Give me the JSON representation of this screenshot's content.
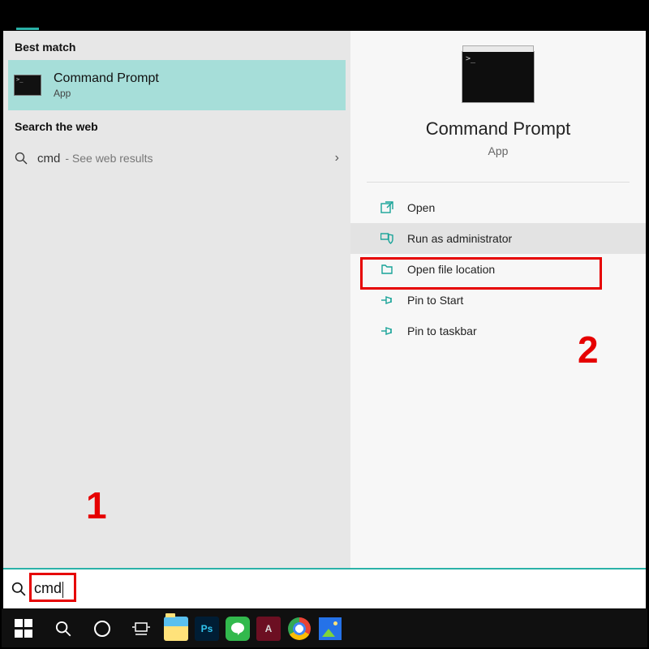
{
  "tabs": {
    "active_indicator": true
  },
  "left": {
    "best_match_heading": "Best match",
    "best_match": {
      "title": "Command Prompt",
      "subtitle": "App"
    },
    "web_heading": "Search the web",
    "web": {
      "query": "cmd",
      "hint": "- See web results"
    }
  },
  "right": {
    "title": "Command Prompt",
    "subtitle": "App",
    "actions": [
      {
        "label": "Open",
        "icon": "open-icon"
      },
      {
        "label": "Run as administrator",
        "icon": "shield-icon",
        "highlight": true
      },
      {
        "label": "Open file location",
        "icon": "folder-icon"
      },
      {
        "label": "Pin to Start",
        "icon": "pin-icon"
      },
      {
        "label": "Pin to taskbar",
        "icon": "pin-icon"
      }
    ]
  },
  "search": {
    "value": "cmd"
  },
  "annotations": {
    "one": "1",
    "two": "2"
  },
  "taskbar": {
    "items": [
      "start",
      "search",
      "cortana",
      "taskview",
      "explorer",
      "photoshop",
      "line",
      "autocad",
      "chrome",
      "photos"
    ]
  }
}
